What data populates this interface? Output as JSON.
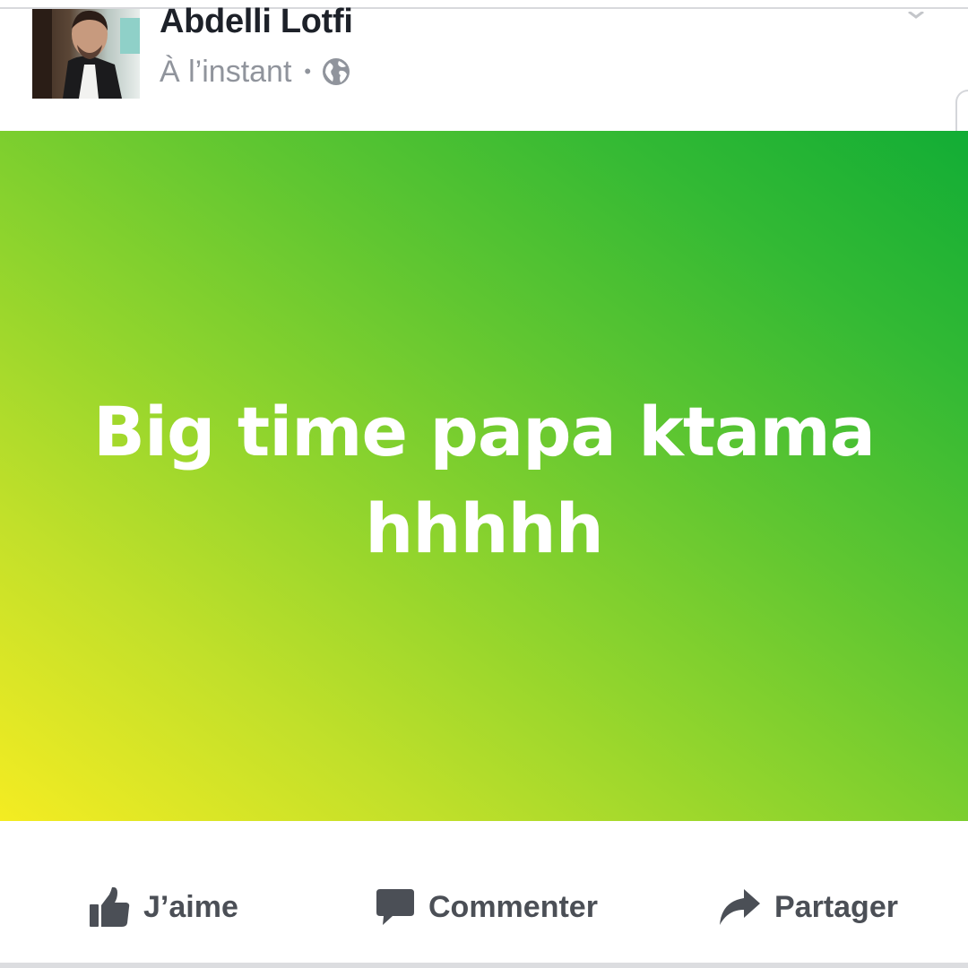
{
  "post": {
    "author_name": "Abdelli Lotfi",
    "timestamp": "À l’instant",
    "separator": "•",
    "privacy_icon": "globe-icon",
    "status_text": "Big time papa ktama hhhhh",
    "background_gradient": [
      "#f4ec22",
      "#8fd42d",
      "#12ad35"
    ]
  },
  "actions": {
    "like_label": "J’aime",
    "like_icon": "thumbs-up-icon",
    "comment_label": "Commenter",
    "comment_icon": "speech-bubble-icon",
    "share_label": "Partager",
    "share_icon": "share-arrow-icon"
  },
  "colors": {
    "author": "#1d2129",
    "meta": "#90949c",
    "action": "#4b4f56"
  }
}
